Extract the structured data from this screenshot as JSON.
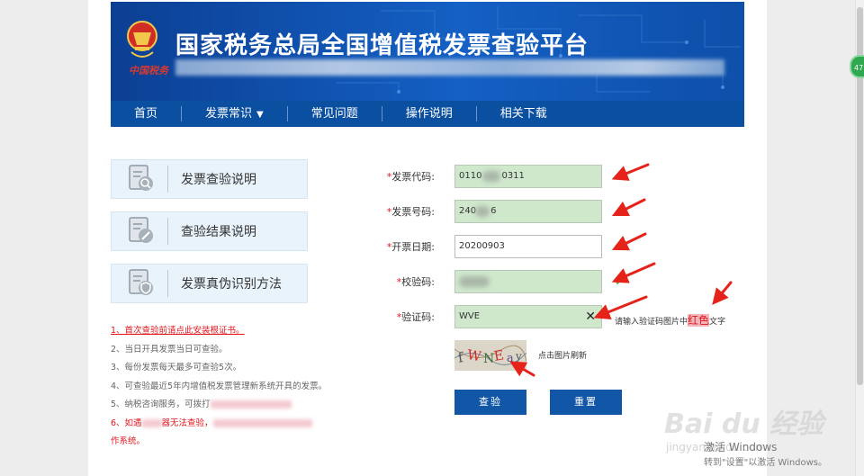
{
  "header": {
    "title": "国家税务总局全国增值税发票查验平台",
    "seal_text": "中国税务",
    "nav": [
      {
        "label": "首页"
      },
      {
        "label": "发票常识"
      },
      {
        "label": "常见问题"
      },
      {
        "label": "操作说明"
      },
      {
        "label": "相关下载"
      }
    ]
  },
  "sidebar": {
    "items": [
      {
        "label": "发票查验说明",
        "icon": "document-search-icon"
      },
      {
        "label": "查验结果说明",
        "icon": "document-edit-icon"
      },
      {
        "label": "发票真伪识别方法",
        "icon": "document-shield-icon"
      }
    ]
  },
  "notes": {
    "n1": "1、首次查验前请点此安装根证书。",
    "n2": "2、当日开具发票当日可查验。",
    "n3": "3、每份发票每天最多可查验5次。",
    "n4": "4、可查验最近5年内增值税发票管理新系统开具的发票。",
    "n5": "5、纳税咨询服务，可拨打",
    "n6a": "6、如遇",
    "n6b": "器无法查验，",
    "n6c": "作系统。"
  },
  "form": {
    "invoice_code_label": "发票代码:",
    "invoice_code_prefix": "0110",
    "invoice_code_suffix": "0311",
    "invoice_number_label": "发票号码:",
    "invoice_number_prefix": "240",
    "invoice_number_suffix": "6",
    "issue_date_label": "开票日期:",
    "issue_date_value": "20200903",
    "check_code_label": "校验码:",
    "captcha_label": "验证码:",
    "captcha_value": "WVE",
    "captcha_hint_pre": "请输入验证码图片中",
    "captcha_hint_red": "红色",
    "captcha_hint_post": "文字",
    "refresh_text": "点击图片刷新",
    "submit_label": "查验",
    "reset_label": "重置"
  },
  "watermark": {
    "logo": "Bai du 经验",
    "sub": "jingyan.baidu.com",
    "activate_title": "激活 Windows",
    "activate_sub": "转到\"设置\"以激活 Windows。"
  },
  "colors": {
    "primary": "#1156a7",
    "required_star": "#e1141c",
    "filled_input": "#cfe8cc"
  }
}
